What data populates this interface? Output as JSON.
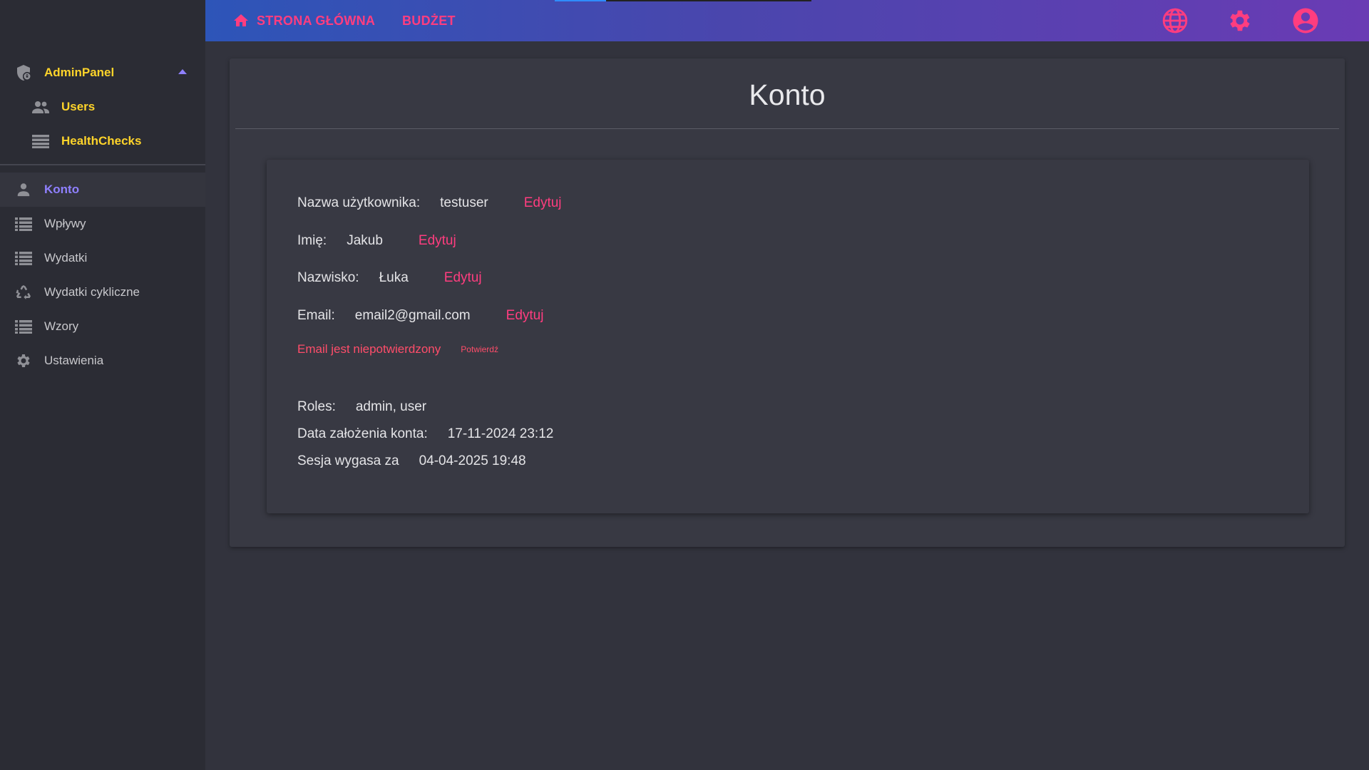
{
  "sidebar": {
    "admin": {
      "label": "AdminPanel",
      "icon": "shield-lock-icon"
    },
    "admin_items": [
      {
        "label": "Users",
        "icon": "people-icon"
      },
      {
        "label": "HealthChecks",
        "icon": "list-icon"
      }
    ],
    "items": [
      {
        "label": "Konto",
        "icon": "person-icon",
        "active": true
      },
      {
        "label": "Wpływy",
        "icon": "list-icon"
      },
      {
        "label": "Wydatki",
        "icon": "list-icon"
      },
      {
        "label": "Wydatki cykliczne",
        "icon": "recycle-icon"
      },
      {
        "label": "Wzory",
        "icon": "list-icon"
      },
      {
        "label": "Ustawienia",
        "icon": "gear-icon"
      }
    ]
  },
  "topbar": {
    "home_label": "STRONA GŁÓWNA",
    "budget_label": "BUDŻET",
    "icons": [
      "globe-icon",
      "gear-icon",
      "account-circle-icon"
    ]
  },
  "account": {
    "title": "Konto",
    "username_label": "Nazwa użytkownika:",
    "username": "testuser",
    "first_name_label": "Imię:",
    "first_name": "Jakub",
    "last_name_label": "Nazwisko:",
    "last_name": "Łuka",
    "email_label": "Email:",
    "email": "email2@gmail.com",
    "edit_label": "Edytuj",
    "email_unconfirmed": "Email jest niepotwierdzony",
    "confirm_label": "Potwierdź",
    "roles_label": "Roles:",
    "roles": "admin, user",
    "created_label": "Data założenia konta:",
    "created": "17-11-2024 23:12",
    "session_label": "Sesja wygasa za",
    "session": "04-04-2025 19:48"
  },
  "colors": {
    "accent": "#ff3d7f",
    "admin_text": "#ffd42a",
    "active_text": "#8f80ff",
    "topbar_start": "#2d55b8",
    "topbar_end": "#6a3bb4"
  }
}
